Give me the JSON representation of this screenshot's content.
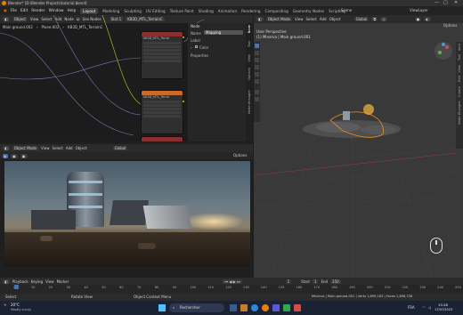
{
  "window": {
    "title": "Blender* [D:\\Blender Projects\\tutorial.blend]"
  },
  "menubar": {
    "items": [
      "File",
      "Edit",
      "Render",
      "Window",
      "Help"
    ],
    "workspaces": [
      "Layout",
      "Modeling",
      "Sculpting",
      "UV Editing",
      "Texture Paint",
      "Shading",
      "Animation",
      "Rendering",
      "Compositing",
      "Geometry Nodes",
      "Scripting"
    ],
    "active_workspace": "Layout",
    "scene": "Scene",
    "view_layer": "ViewLayer"
  },
  "node_editor": {
    "header": {
      "editor": "Object",
      "menus": [
        "View",
        "Select",
        "Add",
        "Node"
      ],
      "use_nodes": "Use Nodes",
      "slot": "Slot 1",
      "material": "KB3D_MTL_TerrainC"
    },
    "breadcrumb": [
      "Main ground.002",
      "Plane.002",
      "KB3D_MTL_TerrainC"
    ],
    "nodes": [
      {
        "title": "KB3D_MTL_Terrai"
      },
      {
        "title": "KB3D_MTL_Terrai"
      },
      {
        "title": "KB3D_MTL_Terrai"
      }
    ],
    "sidebar": {
      "section": "Node",
      "name_label": "Name",
      "name_value": "Mapping",
      "label_label": "Label",
      "color_label": "Color",
      "properties_label": "Properties",
      "tabs": [
        "Node",
        "Tool",
        "View",
        "Options",
        "Node Wrangler"
      ]
    }
  },
  "viewport3d": {
    "header": {
      "mode": "Object Mode",
      "menus": [
        "View",
        "Select",
        "Add",
        "Object"
      ],
      "orientation": "Global",
      "options": "Options"
    },
    "overlay_title": "User Perspective",
    "overlay_subtitle": "(1) Minerva | Main ground.001",
    "tabs": [
      "Item",
      "Tool",
      "View",
      "Edit",
      "Create",
      "Node Wrangler"
    ]
  },
  "render_view": {
    "header": {
      "mode": "Object Mode",
      "menus": [
        "View",
        "Select",
        "Add",
        "Object"
      ],
      "orientation": "Global",
      "options": "Options"
    }
  },
  "timeline": {
    "menus": [
      "Playback",
      "Keying",
      "View",
      "Marker"
    ],
    "current_frame": "1",
    "start_label": "Start",
    "start": "1",
    "end_label": "End",
    "end": "250",
    "ticks": [
      "0",
      "10",
      "20",
      "30",
      "40",
      "50",
      "60",
      "70",
      "80",
      "90",
      "100",
      "110",
      "120",
      "130",
      "140",
      "150",
      "160",
      "170",
      "180",
      "190",
      "200",
      "210",
      "220",
      "230",
      "240",
      "250"
    ]
  },
  "statusbar": {
    "left": "Select",
    "middle": "Rotate View",
    "right": "Object Context Menu",
    "stats": "Minerva | Main ground.001 | Verts 1,899,163 | Faces 1,898,726"
  },
  "taskbar": {
    "weather_temp": "20°C",
    "weather_text": "Mostly sunny",
    "search": "Rechercher",
    "lang": "FRA",
    "time": "15:28",
    "date": "17/07/2023"
  },
  "colors": {
    "accent": "#4772b3",
    "node_header_orange": "#c86a2a",
    "node_header_red": "#8a2f2f",
    "gizmo": "#e8b13a"
  }
}
